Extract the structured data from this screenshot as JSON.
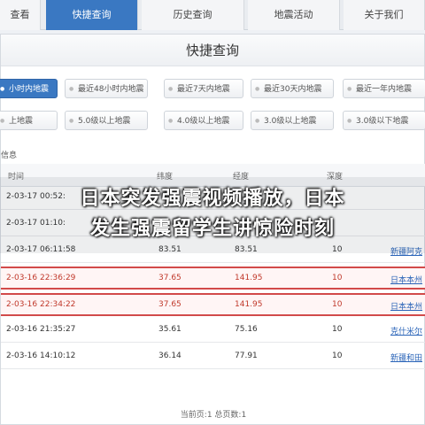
{
  "nav": {
    "tabs": [
      {
        "label": "查看"
      },
      {
        "label": "快捷查询"
      },
      {
        "label": "历史查询"
      },
      {
        "label": "地震活动"
      },
      {
        "label": "关于我们"
      }
    ]
  },
  "panel": {
    "title": "快捷查询",
    "time_buttons": [
      "小时内地震",
      "最近48小时内地震",
      "最近7天内地震",
      "最近30天内地震",
      "最近一年内地震"
    ],
    "mag_buttons": [
      "上地震",
      "5.0级以上地震",
      "4.0级以上地震",
      "3.0级以上地震",
      "3.0级以下地震"
    ],
    "section_label": "信息"
  },
  "table": {
    "headers": [
      "时间",
      "纬度",
      "经度",
      "深度"
    ],
    "rows": [
      {
        "time": "2-03-17 00:52:",
        "lat": "",
        "lon": "",
        "depth": "",
        "loc": "",
        "hl": false
      },
      {
        "time": "2-03-17 01:10:",
        "lat": "",
        "lon": "",
        "depth": "",
        "loc": "",
        "hl": false
      },
      {
        "time": "2-03-17 06:11:58",
        "lat": "83.51",
        "lon": "83.51",
        "depth": "10",
        "loc": "新疆阿克",
        "hl": false
      },
      {
        "time": "2-03-16 22:36:29",
        "lat": "37.65",
        "lon": "141.95",
        "depth": "10",
        "loc": "日本本州",
        "hl": true
      },
      {
        "time": "2-03-16 22:34:22",
        "lat": "37.65",
        "lon": "141.95",
        "depth": "10",
        "loc": "日本本州",
        "hl": true
      },
      {
        "time": "2-03-16 21:35:27",
        "lat": "35.61",
        "lon": "75.16",
        "depth": "10",
        "loc": "克什米尔",
        "hl": false
      },
      {
        "time": "2-03-16 14:10:12",
        "lat": "36.14",
        "lon": "77.91",
        "depth": "10",
        "loc": "新疆和田",
        "hl": false
      }
    ]
  },
  "overlay": {
    "line1": "日本突发强震视频播放，日本",
    "line2": "发生强震留学生讲惊险时刻"
  },
  "pager": {
    "text": "当前页:1    总页数:1"
  }
}
